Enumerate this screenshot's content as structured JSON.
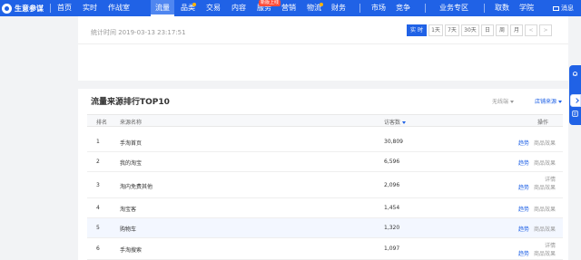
{
  "nav": {
    "logo": "生意参谋",
    "items": [
      "首页",
      "实时",
      "作战室",
      "流量",
      "品类",
      "交易",
      "内容",
      "服务",
      "营销",
      "物流",
      "财务",
      "市场",
      "竞争",
      "业务专区",
      "取数",
      "学院"
    ],
    "active": "流量",
    "new_badge": "新版上线",
    "message": "消息"
  },
  "top_card": {
    "stat_time": "统计时间 2019-03-13 23:17:51",
    "time_buttons": [
      "实 时",
      "1天",
      "7天",
      "30天",
      "日",
      "周",
      "月"
    ],
    "prev": "<",
    "next": ">"
  },
  "traffic": {
    "title": "流量来源排行TOP10",
    "device": "无线端",
    "source_link": "店铺来源",
    "columns": {
      "rank": "排名",
      "source": "来源名称",
      "visitors": "访客数",
      "ops": "操作"
    },
    "rows": [
      {
        "rank": "1",
        "source": "手淘首页",
        "visitors": "30,809",
        "detail": "",
        "trend": "趋势",
        "effect": "商品效果"
      },
      {
        "rank": "2",
        "source": "我的淘宝",
        "visitors": "6,596",
        "detail": "",
        "trend": "趋势",
        "effect": "商品效果"
      },
      {
        "rank": "3",
        "source": "淘内免费其他",
        "visitors": "2,096",
        "detail": "详情",
        "trend": "趋势",
        "effect": "商品效果"
      },
      {
        "rank": "4",
        "source": "淘宝客",
        "visitors": "1,454",
        "detail": "",
        "trend": "趋势",
        "effect": "商品效果"
      },
      {
        "rank": "5",
        "source": "购物车",
        "visitors": "1,320",
        "detail": "",
        "trend": "趋势",
        "effect": "商品效果"
      },
      {
        "rank": "6",
        "source": "手淘搜索",
        "visitors": "1,097",
        "detail": "详情",
        "trend": "趋势",
        "effect": "商品效果"
      }
    ]
  },
  "colors": {
    "primary": "#2062e6",
    "badge": "#ff4d3a",
    "highlight_row": "#f3f7ff"
  },
  "icons": [
    "logo-icon",
    "mail-icon",
    "sort-desc-icon",
    "bell-icon",
    "feedback-icon",
    "collapse-arrow-icon"
  ]
}
